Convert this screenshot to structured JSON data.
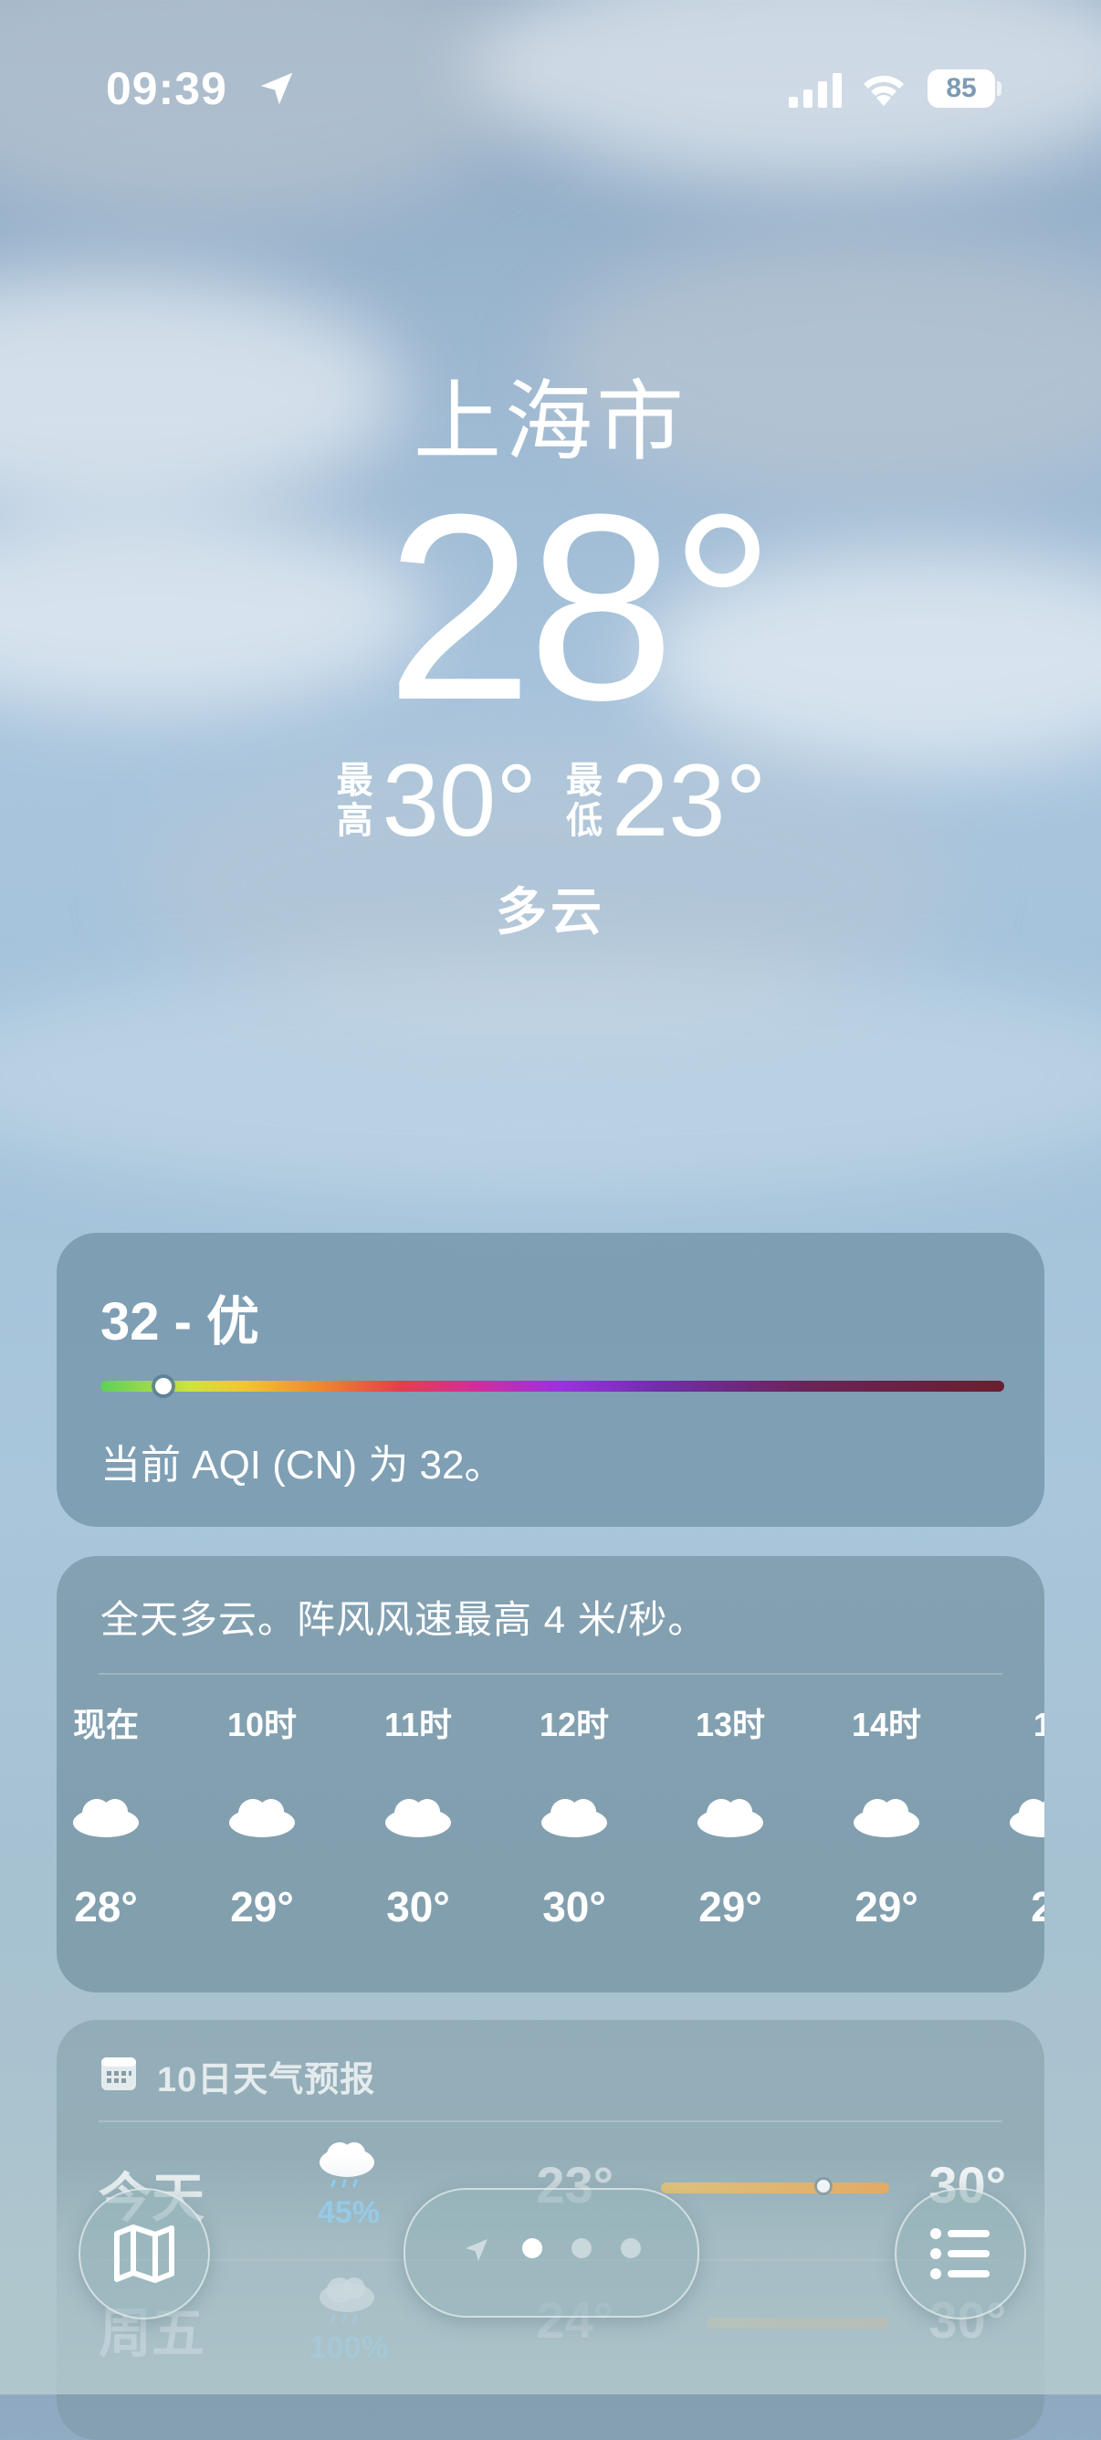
{
  "status_bar": {
    "time": "09:39",
    "battery": "85"
  },
  "current": {
    "city": "上海市",
    "temperature": "28°",
    "high_label": "最高",
    "high": "30°",
    "low_label": "最低",
    "low": "23°",
    "condition": "多云"
  },
  "aqi": {
    "title": "32 - 优",
    "value": 32,
    "description": "当前 AQI (CN) 为 32。"
  },
  "hourly": {
    "summary": "全天多云。阵风风速最高 4 米/秒。",
    "items": [
      {
        "time": "现在",
        "icon": "cloud-icon",
        "temp": "28°"
      },
      {
        "time": "10时",
        "icon": "cloud-icon",
        "temp": "29°"
      },
      {
        "time": "11时",
        "icon": "cloud-icon",
        "temp": "30°"
      },
      {
        "time": "12时",
        "icon": "cloud-icon",
        "temp": "30°"
      },
      {
        "time": "13时",
        "icon": "cloud-icon",
        "temp": "29°"
      },
      {
        "time": "14时",
        "icon": "cloud-icon",
        "temp": "29°"
      },
      {
        "time": "1",
        "icon": "cloud-icon",
        "temp": "2"
      }
    ]
  },
  "daily": {
    "title": "10日天气预报",
    "days": [
      {
        "name": "今天",
        "icon": "cloud-rain-icon",
        "precip": "45%",
        "low": "23°",
        "high": "30°",
        "current_temp_fraction": 0.71
      },
      {
        "name": "周五",
        "icon": "cloud-rain-icon",
        "precip": "100%",
        "low": "24°",
        "high": "30°"
      }
    ]
  },
  "toolbar": {
    "map_icon": "map-icon",
    "list_icon": "list-icon",
    "location_icon": "location-arrow-icon",
    "page_count": 3,
    "active_page": 0
  }
}
